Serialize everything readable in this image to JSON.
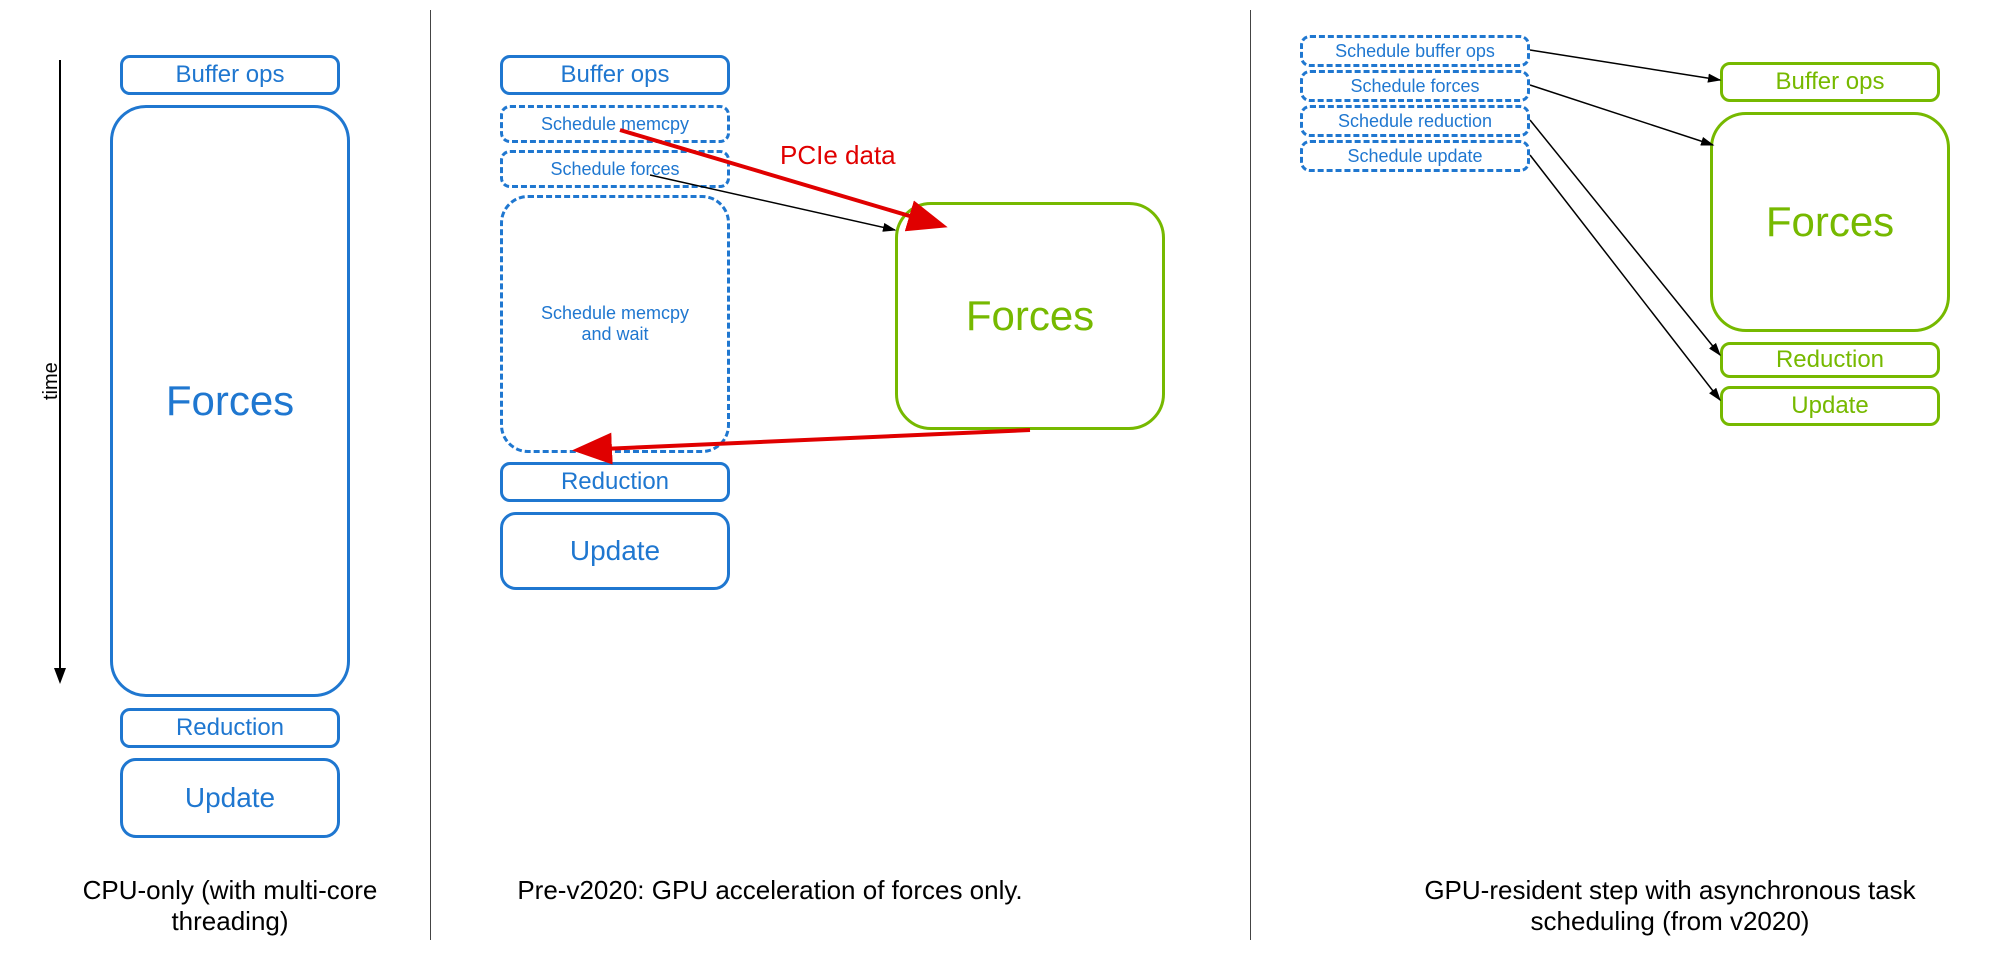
{
  "time_axis": {
    "label": "time"
  },
  "pcie_label": "PCIe data",
  "panel1": {
    "caption": "CPU-only (with multi-core threading)",
    "buffer": "Buffer ops",
    "forces": "Forces",
    "reduction": "Reduction",
    "update": "Update"
  },
  "panel2": {
    "caption": "Pre-v2020: GPU acceleration of forces only.",
    "buffer": "Buffer ops",
    "sched_memcpy": "Schedule memcpy",
    "sched_forces": "Schedule forces",
    "sched_memcpy_wait": "Schedule memcpy and wait",
    "reduction": "Reduction",
    "update": "Update",
    "gpu_forces": "Forces"
  },
  "panel3": {
    "caption": "GPU-resident step with asynchronous task scheduling (from v2020)",
    "sched_buffer": "Schedule buffer ops",
    "sched_forces": "Schedule forces",
    "sched_reduction": "Schedule reduction",
    "sched_update": "Schedule update",
    "gpu_buffer": "Buffer ops",
    "gpu_forces": "Forces",
    "gpu_reduction": "Reduction",
    "gpu_update": "Update"
  }
}
